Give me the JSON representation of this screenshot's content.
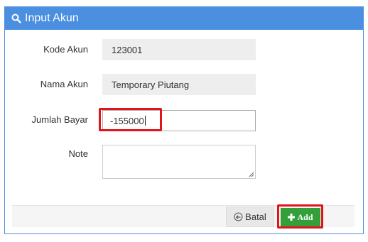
{
  "panel": {
    "title": "Input Akun",
    "header_color": "#4a8fe0"
  },
  "form": {
    "kode_akun": {
      "label": "Kode Akun",
      "value": "123001"
    },
    "nama_akun": {
      "label": "Nama Akun",
      "value": "Temporary Piutang"
    },
    "jumlah_bayar": {
      "label": "Jumlah Bayar",
      "value": "-155000"
    },
    "note": {
      "label": "Note",
      "value": ""
    }
  },
  "buttons": {
    "batal_label": "Batal",
    "add_label": "Add",
    "add_color": "#339f3a"
  },
  "highlight_color": "#e0141b",
  "icons": {
    "header": "search-icon",
    "batal": "undo-icon",
    "add": "plus-icon"
  }
}
